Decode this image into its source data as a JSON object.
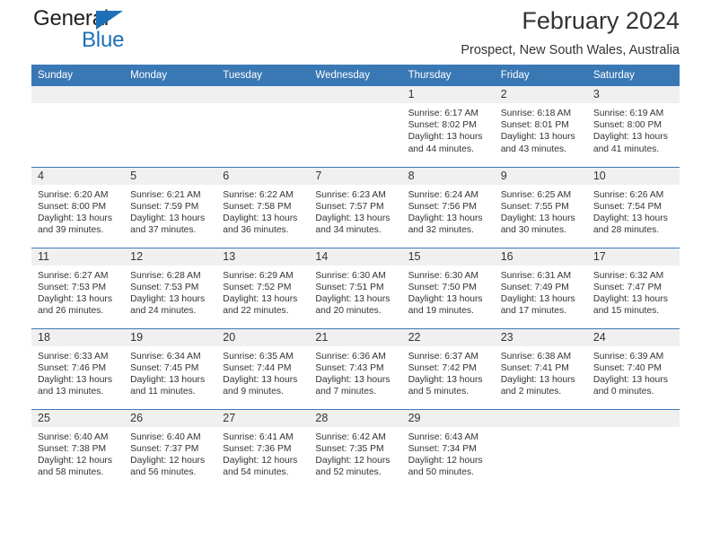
{
  "brand": {
    "name_dark": "General",
    "name_blue": "Blue",
    "accent_color": "#1d70b8"
  },
  "header": {
    "title": "February 2024",
    "subtitle": "Prospect, New South Wales, Australia"
  },
  "theme": {
    "header_row_bg": "#3a78b5",
    "date_strip_bg": "#f0f0f0",
    "text_color": "#333333"
  },
  "calendar": {
    "weekday_headers": [
      "Sunday",
      "Monday",
      "Tuesday",
      "Wednesday",
      "Thursday",
      "Friday",
      "Saturday"
    ],
    "weeks": [
      [
        {
          "day": "",
          "empty": true
        },
        {
          "day": "",
          "empty": true
        },
        {
          "day": "",
          "empty": true
        },
        {
          "day": "",
          "empty": true
        },
        {
          "day": "1",
          "sunrise": "Sunrise: 6:17 AM",
          "sunset": "Sunset: 8:02 PM",
          "daylight": "Daylight: 13 hours and 44 minutes."
        },
        {
          "day": "2",
          "sunrise": "Sunrise: 6:18 AM",
          "sunset": "Sunset: 8:01 PM",
          "daylight": "Daylight: 13 hours and 43 minutes."
        },
        {
          "day": "3",
          "sunrise": "Sunrise: 6:19 AM",
          "sunset": "Sunset: 8:00 PM",
          "daylight": "Daylight: 13 hours and 41 minutes."
        }
      ],
      [
        {
          "day": "4",
          "sunrise": "Sunrise: 6:20 AM",
          "sunset": "Sunset: 8:00 PM",
          "daylight": "Daylight: 13 hours and 39 minutes."
        },
        {
          "day": "5",
          "sunrise": "Sunrise: 6:21 AM",
          "sunset": "Sunset: 7:59 PM",
          "daylight": "Daylight: 13 hours and 37 minutes."
        },
        {
          "day": "6",
          "sunrise": "Sunrise: 6:22 AM",
          "sunset": "Sunset: 7:58 PM",
          "daylight": "Daylight: 13 hours and 36 minutes."
        },
        {
          "day": "7",
          "sunrise": "Sunrise: 6:23 AM",
          "sunset": "Sunset: 7:57 PM",
          "daylight": "Daylight: 13 hours and 34 minutes."
        },
        {
          "day": "8",
          "sunrise": "Sunrise: 6:24 AM",
          "sunset": "Sunset: 7:56 PM",
          "daylight": "Daylight: 13 hours and 32 minutes."
        },
        {
          "day": "9",
          "sunrise": "Sunrise: 6:25 AM",
          "sunset": "Sunset: 7:55 PM",
          "daylight": "Daylight: 13 hours and 30 minutes."
        },
        {
          "day": "10",
          "sunrise": "Sunrise: 6:26 AM",
          "sunset": "Sunset: 7:54 PM",
          "daylight": "Daylight: 13 hours and 28 minutes."
        }
      ],
      [
        {
          "day": "11",
          "sunrise": "Sunrise: 6:27 AM",
          "sunset": "Sunset: 7:53 PM",
          "daylight": "Daylight: 13 hours and 26 minutes."
        },
        {
          "day": "12",
          "sunrise": "Sunrise: 6:28 AM",
          "sunset": "Sunset: 7:53 PM",
          "daylight": "Daylight: 13 hours and 24 minutes."
        },
        {
          "day": "13",
          "sunrise": "Sunrise: 6:29 AM",
          "sunset": "Sunset: 7:52 PM",
          "daylight": "Daylight: 13 hours and 22 minutes."
        },
        {
          "day": "14",
          "sunrise": "Sunrise: 6:30 AM",
          "sunset": "Sunset: 7:51 PM",
          "daylight": "Daylight: 13 hours and 20 minutes."
        },
        {
          "day": "15",
          "sunrise": "Sunrise: 6:30 AM",
          "sunset": "Sunset: 7:50 PM",
          "daylight": "Daylight: 13 hours and 19 minutes."
        },
        {
          "day": "16",
          "sunrise": "Sunrise: 6:31 AM",
          "sunset": "Sunset: 7:49 PM",
          "daylight": "Daylight: 13 hours and 17 minutes."
        },
        {
          "day": "17",
          "sunrise": "Sunrise: 6:32 AM",
          "sunset": "Sunset: 7:47 PM",
          "daylight": "Daylight: 13 hours and 15 minutes."
        }
      ],
      [
        {
          "day": "18",
          "sunrise": "Sunrise: 6:33 AM",
          "sunset": "Sunset: 7:46 PM",
          "daylight": "Daylight: 13 hours and 13 minutes."
        },
        {
          "day": "19",
          "sunrise": "Sunrise: 6:34 AM",
          "sunset": "Sunset: 7:45 PM",
          "daylight": "Daylight: 13 hours and 11 minutes."
        },
        {
          "day": "20",
          "sunrise": "Sunrise: 6:35 AM",
          "sunset": "Sunset: 7:44 PM",
          "daylight": "Daylight: 13 hours and 9 minutes."
        },
        {
          "day": "21",
          "sunrise": "Sunrise: 6:36 AM",
          "sunset": "Sunset: 7:43 PM",
          "daylight": "Daylight: 13 hours and 7 minutes."
        },
        {
          "day": "22",
          "sunrise": "Sunrise: 6:37 AM",
          "sunset": "Sunset: 7:42 PM",
          "daylight": "Daylight: 13 hours and 5 minutes."
        },
        {
          "day": "23",
          "sunrise": "Sunrise: 6:38 AM",
          "sunset": "Sunset: 7:41 PM",
          "daylight": "Daylight: 13 hours and 2 minutes."
        },
        {
          "day": "24",
          "sunrise": "Sunrise: 6:39 AM",
          "sunset": "Sunset: 7:40 PM",
          "daylight": "Daylight: 13 hours and 0 minutes."
        }
      ],
      [
        {
          "day": "25",
          "sunrise": "Sunrise: 6:40 AM",
          "sunset": "Sunset: 7:38 PM",
          "daylight": "Daylight: 12 hours and 58 minutes."
        },
        {
          "day": "26",
          "sunrise": "Sunrise: 6:40 AM",
          "sunset": "Sunset: 7:37 PM",
          "daylight": "Daylight: 12 hours and 56 minutes."
        },
        {
          "day": "27",
          "sunrise": "Sunrise: 6:41 AM",
          "sunset": "Sunset: 7:36 PM",
          "daylight": "Daylight: 12 hours and 54 minutes."
        },
        {
          "day": "28",
          "sunrise": "Sunrise: 6:42 AM",
          "sunset": "Sunset: 7:35 PM",
          "daylight": "Daylight: 12 hours and 52 minutes."
        },
        {
          "day": "29",
          "sunrise": "Sunrise: 6:43 AM",
          "sunset": "Sunset: 7:34 PM",
          "daylight": "Daylight: 12 hours and 50 minutes."
        },
        {
          "day": "",
          "empty": true
        },
        {
          "day": "",
          "empty": true
        }
      ]
    ]
  }
}
